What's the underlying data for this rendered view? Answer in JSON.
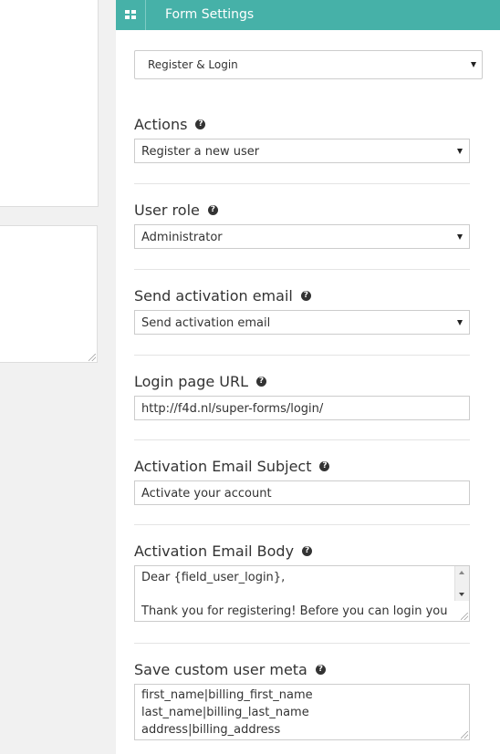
{
  "header": {
    "title": "Form Settings",
    "icon": "grid-icon",
    "color": "#46b1a8"
  },
  "form_type": {
    "selected": "Register & Login"
  },
  "fields": {
    "actions": {
      "label": "Actions",
      "selected": "Register a new user"
    },
    "user_role": {
      "label": "User role",
      "selected": "Administrator"
    },
    "send_activation": {
      "label": "Send activation email",
      "selected": "Send activation email"
    },
    "login_url": {
      "label": "Login page URL",
      "value": "http://f4d.nl/super-forms/login/"
    },
    "email_subject": {
      "label": "Activation Email Subject",
      "value": "Activate your account"
    },
    "email_body": {
      "label": "Activation Email Body",
      "lines": [
        "Dear {field_user_login},",
        "",
        "Thank you for registering! Before you can login you"
      ]
    },
    "user_meta": {
      "label": "Save custom user meta",
      "lines": [
        "first_name|billing_first_name",
        "last_name|billing_last_name",
        "address|billing_address"
      ]
    }
  },
  "help_glyph": "?"
}
